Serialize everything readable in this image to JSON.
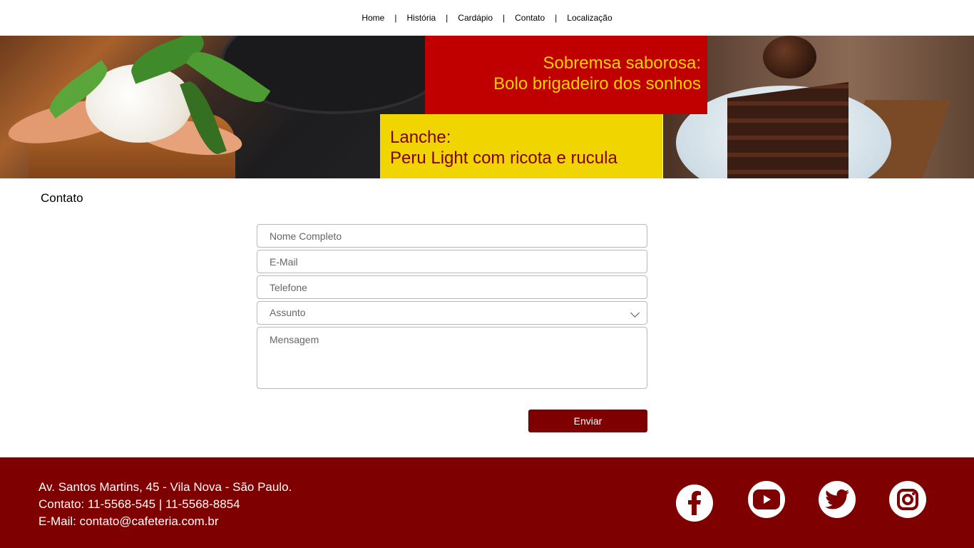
{
  "nav": {
    "items": [
      "Home",
      "História",
      "Cardápio",
      "Contato",
      "Localização"
    ],
    "separator": "|"
  },
  "banner": {
    "dessert_label": "Sobremsa saborosa:",
    "dessert_name": "Bolo brigadeiro dos sonhos",
    "snack_label": "Lanche:",
    "snack_name": "Peru Light com ricota e rucula"
  },
  "contact": {
    "title": "Contato",
    "fields": {
      "name_placeholder": "Nome Completo",
      "email_placeholder": "E-Mail",
      "phone_placeholder": "Telefone",
      "subject_value": "Assunto",
      "message_placeholder": "Mensagem"
    },
    "submit_label": "Enviar"
  },
  "footer": {
    "address": "Av. Santos Martins, 45 - Vila Nova - São Paulo.",
    "phones": "Contato: 11-5568-545 | 11-5568-8854",
    "email": "E-Mail: contato@cafeteria.com.br",
    "social_icons": [
      "facebook-icon",
      "youtube-icon",
      "twitter-icon",
      "instagram-icon"
    ]
  },
  "colors": {
    "brand_dark_red": "#7f0000",
    "promo_red": "#c00000",
    "promo_yellow": "#f0d500"
  }
}
